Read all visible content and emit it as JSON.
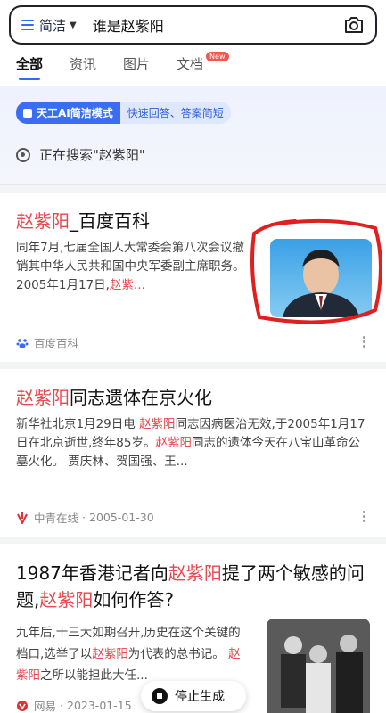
{
  "search": {
    "mode_label": "简洁",
    "query": "谁是赵紫阳"
  },
  "tabs": [
    {
      "label": "全部"
    },
    {
      "label": "资讯"
    },
    {
      "label": "图片"
    },
    {
      "label": "文档",
      "badge": "New"
    }
  ],
  "ai_bar": {
    "pill_label": "天工AI简洁模式",
    "tagline": "快速回答、答案简短",
    "status": "正在搜索\"赵紫阳\""
  },
  "results": [
    {
      "title_hl": "赵紫阳",
      "title_rest": "_百度百科",
      "snippet_a": "同年7月,七届全国人大常委会第八次会议撤销其中华人民共和国中央军委副主席职务。 2005年1月17日,",
      "snippet_hl": "赵紫...",
      "source": "百度百科"
    },
    {
      "title_hl": "赵紫阳",
      "title_rest": "同志遗体在京火化",
      "snippet_a": "新华社北京1月29日电 ",
      "snippet_hl1": "赵紫阳",
      "snippet_b": "同志因病医治无效,于2005年1月17日在北京逝世,终年85岁。",
      "snippet_hl2": "赵紫阳",
      "snippet_c": "同志的遗体今天在八宝山革命公墓火化。 贾庆林、贺国强、王...",
      "source": "中青在线",
      "date": "2005-01-30"
    },
    {
      "title_a": "1987年香港记者向",
      "title_hl1": "赵紫阳",
      "title_b": "提了两个敏感的问题,",
      "title_hl2": "赵紫阳",
      "title_c": "如何作答?",
      "snippet_a": "九年后,十三大如期召开,历史在这个关键的档口,选举了以",
      "snippet_hl1": "赵紫阳",
      "snippet_b": "为代表的总书记。 ",
      "snippet_hl2": "赵紫阳",
      "snippet_c": "之所以能担此大任...",
      "source": "网易",
      "date": "2023-01-15"
    }
  ],
  "stop_button": {
    "label": "停止生成"
  },
  "colors": {
    "accent": "#2f6cf6",
    "highlight": "#e5484d",
    "annotation": "#e02020"
  }
}
